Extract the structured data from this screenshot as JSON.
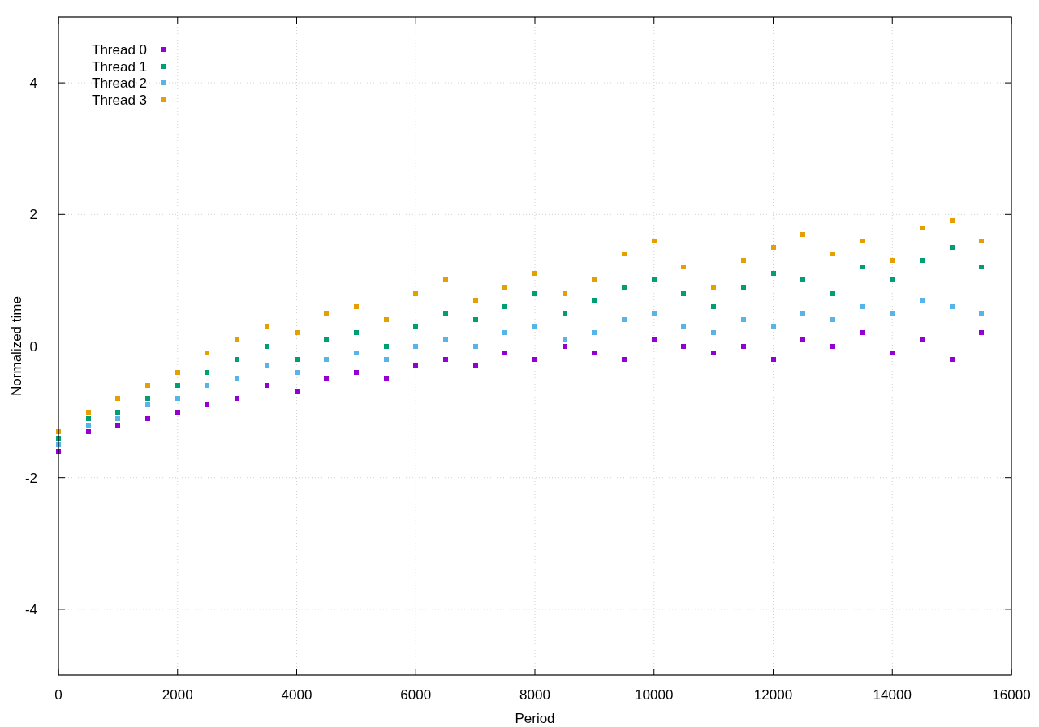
{
  "chart_data": {
    "type": "scatter",
    "xlabel": "Period",
    "ylabel": "Normalized time",
    "x": [
      0,
      500,
      1000,
      1500,
      2000,
      2500,
      3000,
      3500,
      4000,
      4500,
      5000,
      5500,
      6000,
      6500,
      7000,
      7500,
      8000,
      8500,
      9000,
      9500,
      10000,
      10500,
      11000,
      11500,
      12000,
      12500,
      13000,
      13500,
      14000,
      14500,
      15000,
      15500
    ],
    "series": [
      {
        "name": "Thread 0",
        "color": "#9400d3",
        "values": [
          -1.6,
          -1.3,
          -1.2,
          -1.1,
          -1.0,
          -0.9,
          -0.8,
          -0.6,
          -0.7,
          -0.5,
          -0.4,
          -0.5,
          -0.3,
          -0.2,
          -0.3,
          -0.1,
          -0.2,
          0.0,
          -0.1,
          -0.2,
          0.1,
          0.0,
          -0.1,
          0.0,
          -0.2,
          0.1,
          0.0,
          0.2,
          -0.1,
          0.1,
          -0.2,
          0.2
        ]
      },
      {
        "name": "Thread 1",
        "color": "#009e73",
        "values": [
          -1.4,
          -1.1,
          -1.0,
          -0.8,
          -0.6,
          -0.4,
          -0.2,
          0.0,
          -0.2,
          0.1,
          0.2,
          0.0,
          0.3,
          0.5,
          0.4,
          0.6,
          0.8,
          0.5,
          0.7,
          0.9,
          1.0,
          0.8,
          0.6,
          0.9,
          1.1,
          1.0,
          0.8,
          1.2,
          1.0,
          1.3,
          1.5,
          1.2
        ]
      },
      {
        "name": "Thread 2",
        "color": "#56b4e9",
        "values": [
          -1.5,
          -1.2,
          -1.1,
          -0.9,
          -0.8,
          -0.6,
          -0.5,
          -0.3,
          -0.4,
          -0.2,
          -0.1,
          -0.2,
          0.0,
          0.1,
          0.0,
          0.2,
          0.3,
          0.1,
          0.2,
          0.4,
          0.5,
          0.3,
          0.2,
          0.4,
          0.3,
          0.5,
          0.4,
          0.6,
          0.5,
          0.7,
          0.6,
          0.5
        ]
      },
      {
        "name": "Thread 3",
        "color": "#e69f00",
        "values": [
          -1.3,
          -1.0,
          -0.8,
          -0.6,
          -0.4,
          -0.1,
          0.1,
          0.3,
          0.2,
          0.5,
          0.6,
          0.4,
          0.8,
          1.0,
          0.7,
          0.9,
          1.1,
          0.8,
          1.0,
          1.4,
          1.6,
          1.2,
          0.9,
          1.3,
          1.5,
          1.7,
          1.4,
          1.6,
          1.3,
          1.8,
          1.9,
          1.6
        ]
      }
    ],
    "xlim": [
      0,
      16000
    ],
    "ylim": [
      -5,
      5
    ],
    "xticks": [
      0,
      2000,
      4000,
      6000,
      8000,
      10000,
      12000,
      14000,
      16000
    ],
    "yticks": [
      -4,
      -2,
      0,
      2,
      4
    ],
    "grid": true,
    "legend": "upper left"
  }
}
